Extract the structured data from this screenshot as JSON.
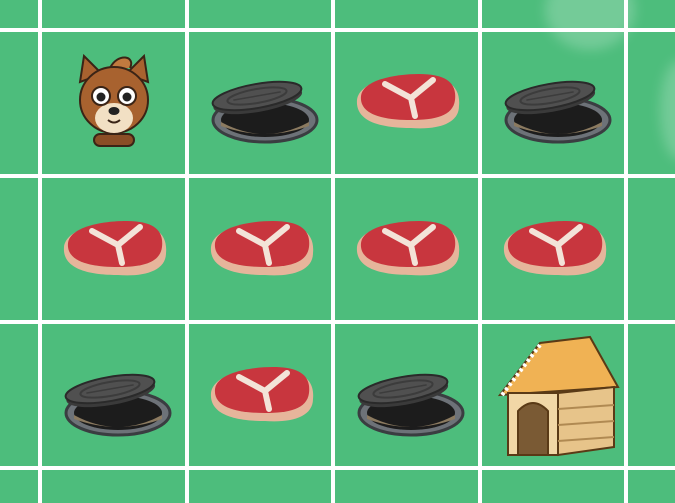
{
  "board": {
    "rows": 3,
    "cols": 4,
    "grid": [
      [
        "dog",
        "manhole",
        "steak",
        "manhole"
      ],
      [
        "steak",
        "steak",
        "steak",
        "steak"
      ],
      [
        "manhole",
        "steak",
        "manhole",
        "doghouse"
      ]
    ]
  },
  "colors": {
    "field": "#4dbd7c",
    "grid_line": "#ffffff",
    "meat": "#c8363e",
    "bone": "#f3e3d8",
    "manhole_lid": "#505050",
    "doghouse_roof": "#f0b254",
    "doghouse_wall": "#f1d7a6",
    "dog_fur": "#a8622f"
  },
  "icons": {
    "dog": "dog-icon",
    "manhole": "manhole-icon",
    "steak": "steak-icon",
    "doghouse": "doghouse-icon"
  }
}
